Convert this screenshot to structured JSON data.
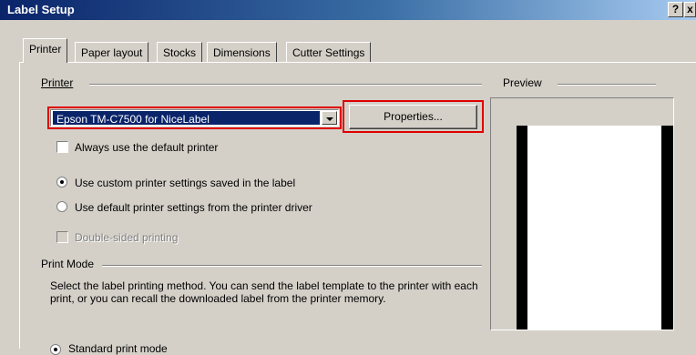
{
  "window": {
    "title": "Label Setup",
    "help_button": "?",
    "close_button": "x"
  },
  "tabs": [
    {
      "label": "Printer",
      "active": true
    },
    {
      "label": "Paper layout",
      "active": false
    },
    {
      "label": "Stocks",
      "active": false
    },
    {
      "label": "Dimensions",
      "active": false
    },
    {
      "label": "Cutter Settings",
      "active": false
    }
  ],
  "printer_group": {
    "label": "Printer",
    "selected_printer": "Epson TM-C7500 for NiceLabel",
    "properties_button": "Properties...",
    "always_default_label": "Always use the default printer",
    "always_default_checked": false,
    "custom_settings_label": "Use custom printer settings saved in the label",
    "custom_settings_selected": true,
    "driver_settings_label": "Use default printer settings from the printer driver",
    "driver_settings_selected": false,
    "double_sided_label": "Double-sided printing",
    "double_sided_enabled": false
  },
  "print_mode": {
    "label": "Print Mode",
    "description": "Select the label printing method. You can send the label template to the printer with each print, or you can recall the downloaded label from the printer memory.",
    "standard_label": "Standard print mode"
  },
  "preview": {
    "label": "Preview"
  },
  "colors": {
    "highlight_outline": "#e00000",
    "selection": "#0a246a",
    "dialog_bg": "#d4d0c8"
  }
}
